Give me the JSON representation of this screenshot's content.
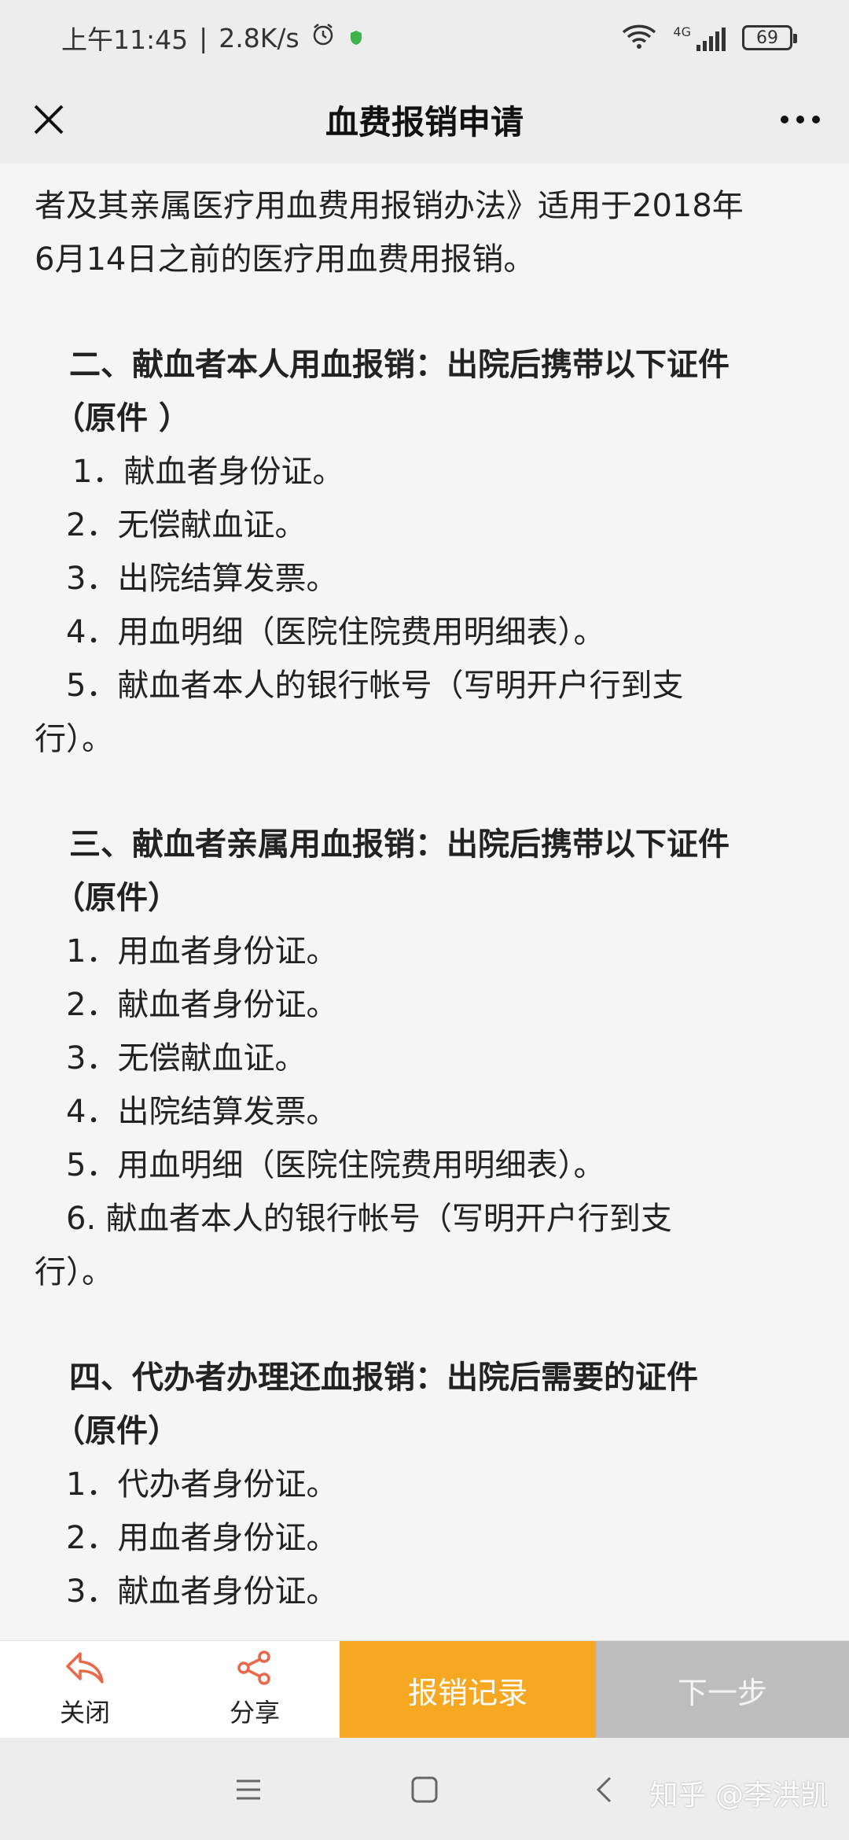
{
  "status": {
    "time": "上午11:45",
    "speed": "2.8K/s",
    "network": "4G",
    "battery": "69"
  },
  "header": {
    "title": "血费报销申请"
  },
  "content": {
    "intro_line1": "者及其亲属医疗用血费用报销办法》适用于2018年",
    "intro_line2": "6月14日之前的医疗用血费用报销。",
    "section2": {
      "heading_line1": "二、献血者本人用血报销：出院后携带以下证件",
      "heading_line2": "（原件 ）",
      "items": [
        "1．献血者身份证。",
        "2．无偿献血证。",
        "3．出院结算发票。",
        "4．用血明细（医院住院费用明细表）。",
        "5．献血者本人的银行帐号（写明开户行到支"
      ],
      "item5_cont": "行）。"
    },
    "section3": {
      "heading_line1": "三、献血者亲属用血报销：出院后携带以下证件",
      "heading_line2": "（原件）",
      "items": [
        "1．用血者身份证。",
        "2．献血者身份证。",
        "3．无偿献血证。",
        "4．出院结算发票。",
        "5．用血明细（医院住院费用明细表）。",
        "6. 献血者本人的银行帐号（写明开户行到支"
      ],
      "item6_cont": "行）。"
    },
    "section4": {
      "heading_line1": "四、代办者办理还血报销：出院后需要的证件",
      "heading_line2": "（原件）",
      "items": [
        "1．代办者身份证。",
        "2．用血者身份证。",
        "3．献血者身份证。"
      ]
    }
  },
  "actions": {
    "close_label": "关闭",
    "share_label": "分享",
    "records_label": "报销记录",
    "next_label": "下一步"
  },
  "watermark": "知乎 @李洪凯",
  "colors": {
    "accent": "#f7a823",
    "disabled": "#bdbdbd",
    "icon": "#e8684a"
  }
}
